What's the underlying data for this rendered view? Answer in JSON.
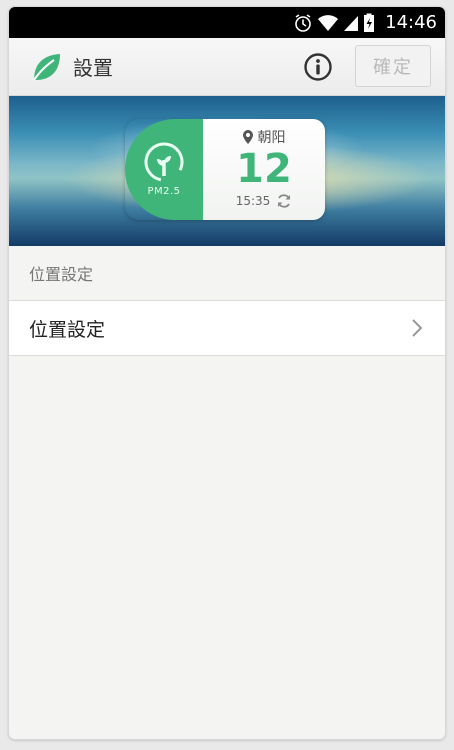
{
  "status_bar": {
    "time": "14:46",
    "icons": [
      "alarm-icon",
      "wifi-icon",
      "signal-icon",
      "battery-icon"
    ]
  },
  "header": {
    "title": "設置",
    "info_icon": "info-icon",
    "confirm_label": "確定"
  },
  "widget": {
    "pm_label": "PM2.5",
    "location": "朝阳",
    "value": "12",
    "updated_time": "15:35",
    "accent_color": "#3fb57a"
  },
  "section": {
    "header": "位置設定",
    "rows": [
      {
        "label": "位置設定",
        "icon": "chevron-right-icon"
      }
    ]
  }
}
